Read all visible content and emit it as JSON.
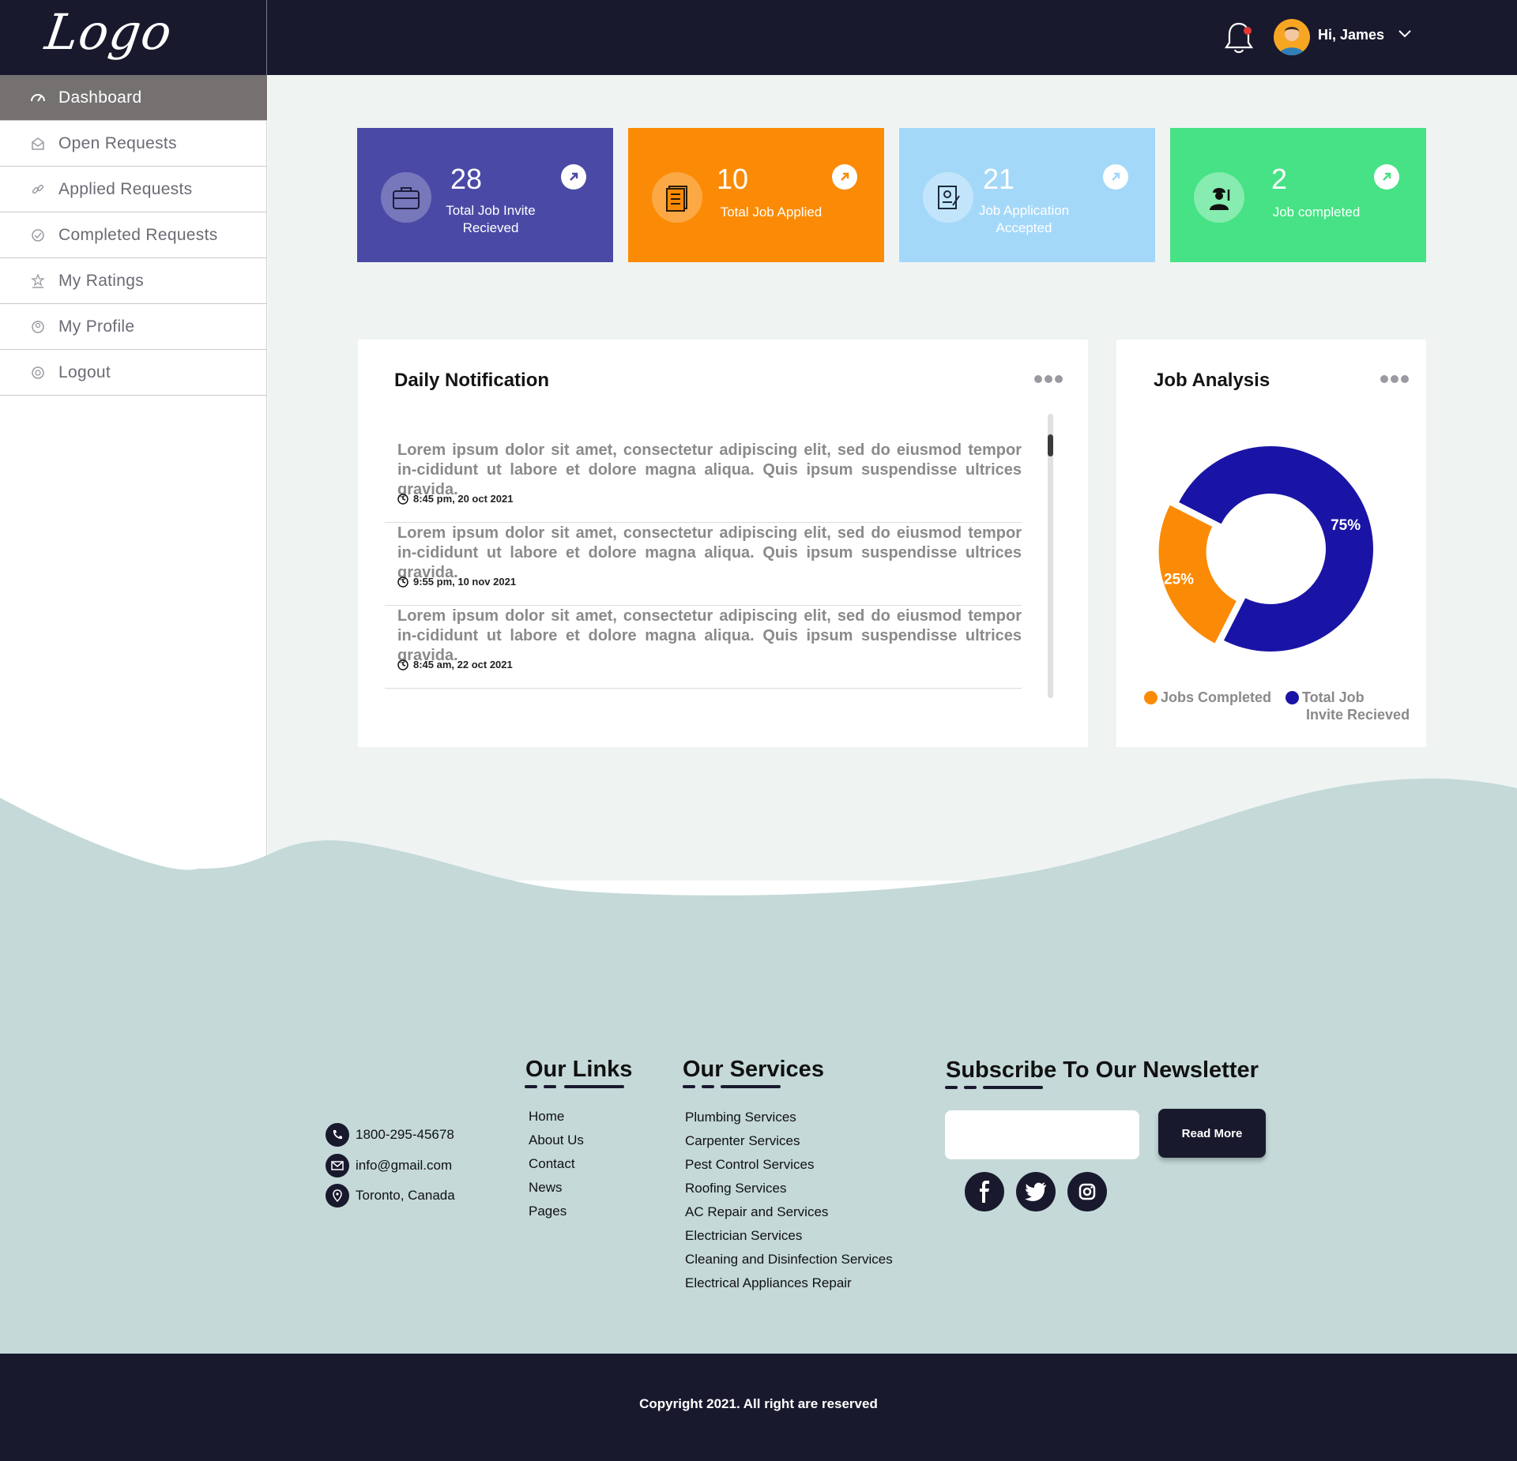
{
  "header": {
    "logo": "Logo",
    "greeting": "Hi, James"
  },
  "sidebar": {
    "items": [
      {
        "label": "Dashboard",
        "icon": "gauge-icon"
      },
      {
        "label": "Open Requests",
        "icon": "envelope-open-icon"
      },
      {
        "label": "Applied Requests",
        "icon": "link-icon"
      },
      {
        "label": "Completed Requests",
        "icon": "check-circle-icon"
      },
      {
        "label": "My Ratings",
        "icon": "ratings-icon"
      },
      {
        "label": "My Profile",
        "icon": "profile-icon"
      },
      {
        "label": "Logout",
        "icon": "logout-icon"
      }
    ]
  },
  "stats": [
    {
      "value": "28",
      "label_line1": "Total Job Invite",
      "label_line2": "Recieved",
      "color": "#4a4aa6",
      "icon": "briefcase-icon"
    },
    {
      "value": "10",
      "label_line1": "Total Job Applied",
      "label_line2": "",
      "color": "#fb8b06",
      "icon": "document-list-icon"
    },
    {
      "value": "21",
      "label_line1": "Job Application",
      "label_line2": "Accepted",
      "color": "#a4d8f9",
      "icon": "certificate-icon"
    },
    {
      "value": "2",
      "label_line1": "Job completed",
      "label_line2": "",
      "color": "#46e285",
      "icon": "worker-icon"
    }
  ],
  "notifications": {
    "title": "Daily Notification",
    "items": [
      {
        "text": "Lorem ipsum dolor sit amet, consectetur adipiscing elit, sed do eiusmod tempor in-cididunt ut labore et dolore magna aliqua. Quis ipsum suspendisse ultrices gravida.",
        "time": "8:45 pm, 20 oct 2021"
      },
      {
        "text": "Lorem ipsum dolor sit amet, consectetur adipiscing elit, sed do eiusmod tempor in-cididunt ut labore et dolore magna aliqua. Quis ipsum suspendisse ultrices gravida.",
        "time": "9:55 pm, 10 nov 2021"
      },
      {
        "text": "Lorem ipsum dolor sit amet, consectetur adipiscing elit, sed do eiusmod tempor in-cididunt ut labore et dolore magna aliqua. Quis ipsum suspendisse ultrices gravida.",
        "time": "8:45 am, 22 oct  2021"
      }
    ]
  },
  "job_analysis": {
    "title": "Job Analysis",
    "legend_completed": "Jobs Completed",
    "legend_invite_line1": "Total Job",
    "legend_invite_line2": "Invite Recieved"
  },
  "chart_data": {
    "type": "pie",
    "title": "Job Analysis",
    "labels": [
      "Jobs Completed",
      "Total Job Invite Recieved"
    ],
    "values": [
      25,
      75
    ],
    "value_labels": [
      "25%",
      "75%"
    ],
    "colors": [
      "#fb8b06",
      "#1a14a6"
    ],
    "legend": "bottom"
  },
  "footer": {
    "contact": {
      "phone": "1800-295-45678",
      "email": "info@gmail.com",
      "location": "Toronto, Canada"
    },
    "links_heading": "Our Links",
    "links": [
      "Home",
      "About Us",
      "Contact",
      "News",
      "Pages"
    ],
    "services_heading": "Our Services",
    "services": [
      "Plumbing Services",
      "Carpenter Services",
      "Pest Control Services",
      "Roofing Services",
      "AC Repair and Services",
      "Electrician Services",
      "Cleaning and Disinfection Services",
      "Electrical Appliances Repair"
    ],
    "newsletter_heading": "Subscribe To Our Newsletter",
    "newsletter_button": "Read More",
    "social": [
      "facebook-icon",
      "twitter-icon",
      "instagram-icon"
    ],
    "copyright": "Copyright 2021. All right are reserved"
  }
}
